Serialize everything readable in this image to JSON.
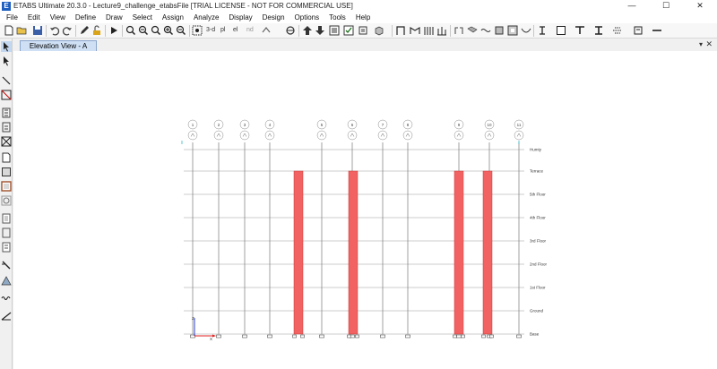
{
  "window": {
    "title": "ETABS Ultimate 20.3.0 - Lecture9_challenge_etabsFile  [TRIAL LICENSE - NOT FOR COMMERCIAL USE]",
    "app_icon_text": "E",
    "minimize": "—",
    "maximize": "☐",
    "close": "✕"
  },
  "menu": {
    "items": [
      "File",
      "Edit",
      "View",
      "Define",
      "Draw",
      "Select",
      "Assign",
      "Analyze",
      "Display",
      "Design",
      "Options",
      "Tools",
      "Help"
    ]
  },
  "toolbar": {
    "view_3d_label": "3-d",
    "plan_label": "pl",
    "elev_label": "el",
    "nd_label": "nd"
  },
  "document": {
    "tab_label": "Elevation View - A",
    "tab_dropdown": "▾",
    "tab_close": "✕"
  },
  "elevation": {
    "grid_labels": [
      "1",
      "2",
      "3",
      "4",
      "5",
      "6",
      "7",
      "8",
      "9",
      "10",
      "11"
    ],
    "story_labels": [
      "Humty",
      "Terrace",
      "5th Floor",
      "4th Floor",
      "3rd Floor",
      "2nd Floor",
      "1st Floor",
      "Ground",
      "Base"
    ],
    "axis_labels": {
      "z": "Z",
      "x": "X"
    },
    "wall_color": "#f26262",
    "line_color": "#7a7a7a"
  }
}
